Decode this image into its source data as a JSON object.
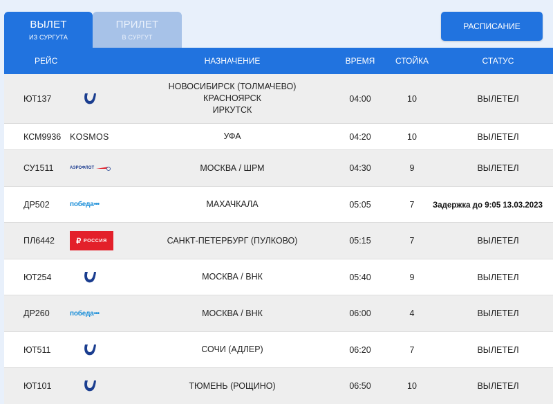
{
  "tabs": [
    {
      "main": "ВЫЛЕТ",
      "sub": "ИЗ СУРГУТА"
    },
    {
      "main": "ПРИЛЕТ",
      "sub": "В СУРГУТ"
    }
  ],
  "schedule_button": "РАСПИСАНИЕ",
  "columns": {
    "flight": "РЕЙС",
    "destination": "НАЗНАЧЕНИЕ",
    "time": "ВРЕМЯ",
    "desk": "СТОЙКА",
    "status": "СТАТУС"
  },
  "rows": [
    {
      "flight": "ЮТ137",
      "logo": "utair-logo",
      "dest1": "НОВОСИБИРСК (ТОЛМАЧЕВО)",
      "dest2": "КРАСНОЯРСК",
      "dest3": "ИРКУТСК",
      "time": "04:00",
      "desk": "10",
      "status": "ВЫЛЕТЕЛ"
    },
    {
      "flight": "КСМ9936",
      "logo": "kosmos-logo",
      "logo_text": "KOSMOS",
      "dest1": "УФА",
      "time": "04:20",
      "desk": "10",
      "status": "ВЫЛЕТЕЛ"
    },
    {
      "flight": "СУ1511",
      "logo": "aeroflot-logo",
      "logo_text": "АЭРОФЛОТ",
      "dest1": "МОСКВА / ШРМ",
      "time": "04:30",
      "desk": "9",
      "status": "ВЫЛЕТЕЛ"
    },
    {
      "flight": "ДР502",
      "logo": "pobeda-logo",
      "logo_text": "победа",
      "dest1": "МАХАЧКАЛА",
      "time": "05:05",
      "desk": "7",
      "status": "Задержка до 9:05 13.03.2023"
    },
    {
      "flight": "ПЛ6442",
      "logo": "rossiya-logo",
      "logo_text": "РОССИЯ",
      "dest1": "САНКТ-ПЕТЕРБУРГ (ПУЛКОВО)",
      "time": "05:15",
      "desk": "7",
      "status": "ВЫЛЕТЕЛ"
    },
    {
      "flight": "ЮТ254",
      "logo": "utair-logo",
      "dest1": "МОСКВА / ВНК",
      "time": "05:40",
      "desk": "9",
      "status": "ВЫЛЕТЕЛ"
    },
    {
      "flight": "ДР260",
      "logo": "pobeda-logo",
      "logo_text": "победа",
      "dest1": "МОСКВА / ВНК",
      "time": "06:00",
      "desk": "4",
      "status": "ВЫЛЕТЕЛ"
    },
    {
      "flight": "ЮТ511",
      "logo": "utair-logo",
      "dest1": "СОЧИ (АДЛЕР)",
      "time": "06:20",
      "desk": "7",
      "status": "ВЫЛЕТЕЛ"
    },
    {
      "flight": "ЮТ101",
      "logo": "utair-logo",
      "dest1": "ТЮМЕНЬ (РОЩИНО)",
      "time": "06:50",
      "desk": "10",
      "status": "ВЫЛЕТЕЛ"
    }
  ]
}
